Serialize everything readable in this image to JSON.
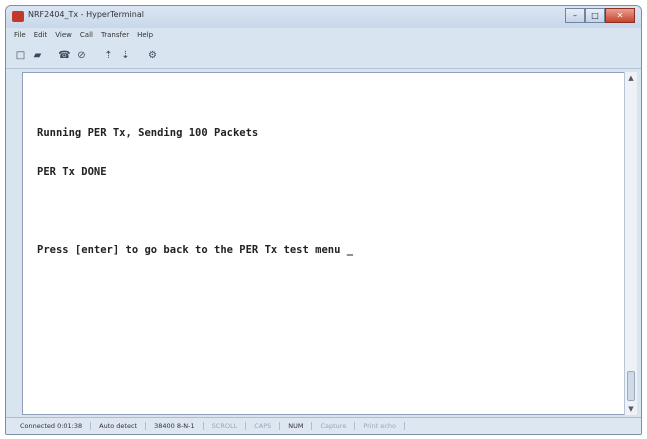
{
  "window": {
    "title": "NRF2404_Tx - HyperTerminal",
    "controls": {
      "minimize": "–",
      "maximize": "□",
      "close": "✕"
    }
  },
  "menu": [
    "File",
    "Edit",
    "View",
    "Call",
    "Transfer",
    "Help"
  ],
  "toolbar": [
    {
      "icon": "new-connection-icon",
      "glyph": "□"
    },
    {
      "icon": "open-icon",
      "glyph": "▰"
    },
    {
      "icon": "dial-icon",
      "glyph": "☎"
    },
    {
      "icon": "disconnect-icon",
      "glyph": "⊘"
    },
    {
      "icon": "send-icon",
      "glyph": "⇡"
    },
    {
      "icon": "receive-icon",
      "glyph": "⇣"
    },
    {
      "icon": "properties-icon",
      "glyph": "⚙"
    }
  ],
  "terminal": {
    "lines": [
      "Running PER Tx, Sending 100 Packets",
      "PER Tx DONE",
      "",
      "Press [enter] to go back to the PER Tx test menu _"
    ]
  },
  "status": {
    "connected": "Connected 0:01:38",
    "detect": "Auto detect",
    "settings": "38400 8-N-1",
    "scroll": "SCROLL",
    "caps": "CAPS",
    "num": "NUM",
    "capture": "Capture",
    "printecho": "Print echo"
  },
  "colors": {
    "title_bar": "#c8d7ea",
    "terminal_bg": "#ffffff",
    "close_button": "#c7432d"
  }
}
